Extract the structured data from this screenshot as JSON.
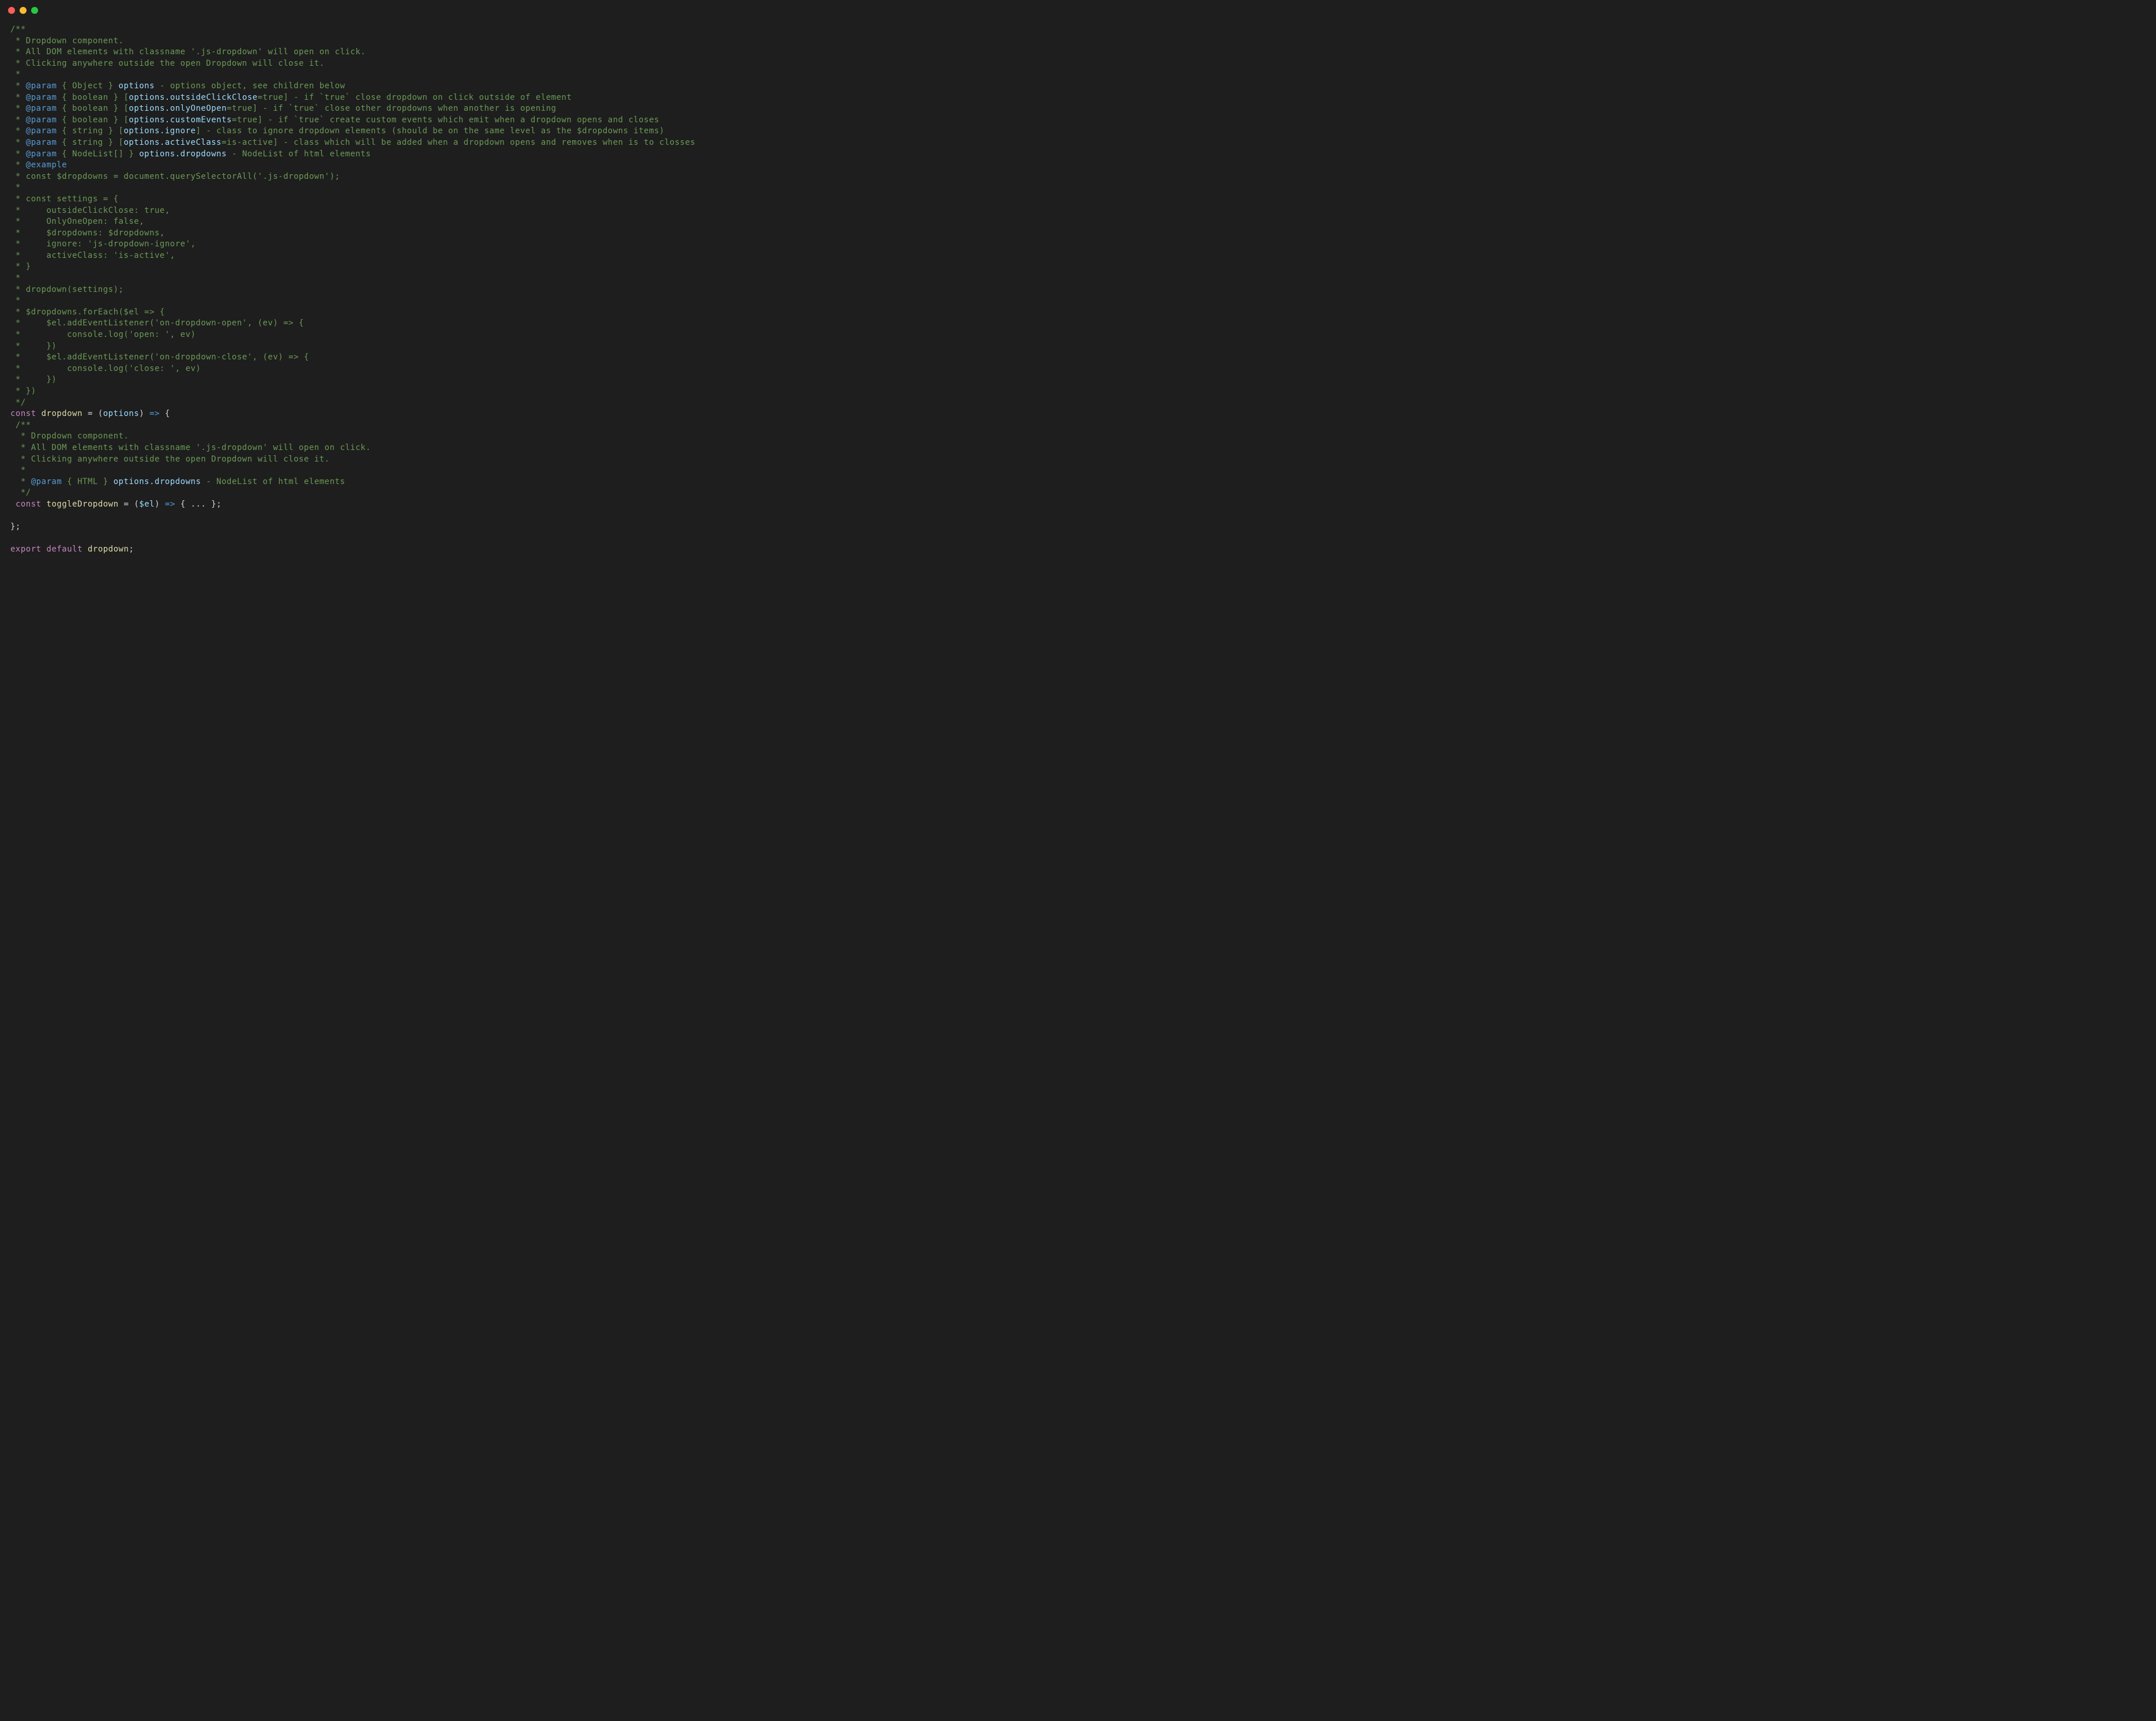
{
  "window": {
    "buttons": [
      "close",
      "minimize",
      "zoom"
    ]
  },
  "lines": [
    [
      [
        "c-comment",
        "/**"
      ]
    ],
    [
      [
        "c-comment",
        " * Dropdown component."
      ]
    ],
    [
      [
        "c-comment",
        " * All DOM elements with classname '.js-dropdown' will open on click."
      ]
    ],
    [
      [
        "c-comment",
        " * Clicking anywhere outside the open Dropdown will close it."
      ]
    ],
    [
      [
        "c-comment",
        " *"
      ]
    ],
    [
      [
        "c-comment",
        " * "
      ],
      [
        "c-tag",
        "@param"
      ],
      [
        "c-comment",
        " { Object } "
      ],
      [
        "c-param",
        "options"
      ],
      [
        "c-comment",
        " - options object, see children below"
      ]
    ],
    [
      [
        "c-comment",
        " * "
      ],
      [
        "c-tag",
        "@param"
      ],
      [
        "c-comment",
        " { boolean } ["
      ],
      [
        "c-param",
        "options.outsideClickClose"
      ],
      [
        "c-comment",
        "=true] - if `true` close dropdown on click outside of element"
      ]
    ],
    [
      [
        "c-comment",
        " * "
      ],
      [
        "c-tag",
        "@param"
      ],
      [
        "c-comment",
        " { boolean } ["
      ],
      [
        "c-param",
        "options.onlyOneOpen"
      ],
      [
        "c-comment",
        "=true] - if `true` close other dropdowns when another is opening"
      ]
    ],
    [
      [
        "c-comment",
        " * "
      ],
      [
        "c-tag",
        "@param"
      ],
      [
        "c-comment",
        " { boolean } ["
      ],
      [
        "c-param",
        "options.customEvents"
      ],
      [
        "c-comment",
        "=true] - if `true` create custom events which emit when a dropdown opens and closes"
      ]
    ],
    [
      [
        "c-comment",
        " * "
      ],
      [
        "c-tag",
        "@param"
      ],
      [
        "c-comment",
        " { string } ["
      ],
      [
        "c-param",
        "options.ignore"
      ],
      [
        "c-comment",
        "] - class to ignore dropdown elements (should be on the same level as the $dropdowns items)"
      ]
    ],
    [
      [
        "c-comment",
        " * "
      ],
      [
        "c-tag",
        "@param"
      ],
      [
        "c-comment",
        " { string } ["
      ],
      [
        "c-param",
        "options.activeClass"
      ],
      [
        "c-comment",
        "=is-active] - class which will be added when a dropdown opens and removes when is to closses"
      ]
    ],
    [
      [
        "c-comment",
        " * "
      ],
      [
        "c-tag",
        "@param"
      ],
      [
        "c-comment",
        " { NodeList[] } "
      ],
      [
        "c-param",
        "options.dropdowns"
      ],
      [
        "c-comment",
        " - NodeList of html elements"
      ]
    ],
    [
      [
        "c-comment",
        " * "
      ],
      [
        "c-tag",
        "@example"
      ]
    ],
    [
      [
        "c-comment",
        " * const $dropdowns = document.querySelectorAll('.js-dropdown');"
      ]
    ],
    [
      [
        "c-comment",
        " *"
      ]
    ],
    [
      [
        "c-comment",
        " * const settings = {"
      ]
    ],
    [
      [
        "c-comment",
        " *     outsideClickClose: true,"
      ]
    ],
    [
      [
        "c-comment",
        " *     OnlyOneOpen: false,"
      ]
    ],
    [
      [
        "c-comment",
        " *     $dropdowns: $dropdowns,"
      ]
    ],
    [
      [
        "c-comment",
        " *     ignore: 'js-dropdown-ignore',"
      ]
    ],
    [
      [
        "c-comment",
        " *     activeClass: 'is-active',"
      ]
    ],
    [
      [
        "c-comment",
        " * }"
      ]
    ],
    [
      [
        "c-comment",
        " *"
      ]
    ],
    [
      [
        "c-comment",
        " * dropdown(settings);"
      ]
    ],
    [
      [
        "c-comment",
        " *"
      ]
    ],
    [
      [
        "c-comment",
        " * $dropdowns.forEach($el => {"
      ]
    ],
    [
      [
        "c-comment",
        " *     $el.addEventListener('on-dropdown-open', (ev) => {"
      ]
    ],
    [
      [
        "c-comment",
        " *         console.log('open: ', ev)"
      ]
    ],
    [
      [
        "c-comment",
        " *     })"
      ]
    ],
    [
      [
        "c-comment",
        " *     $el.addEventListener('on-dropdown-close', (ev) => {"
      ]
    ],
    [
      [
        "c-comment",
        " *         console.log('close: ', ev)"
      ]
    ],
    [
      [
        "c-comment",
        " *     })"
      ]
    ],
    [
      [
        "c-comment",
        " * })"
      ]
    ],
    [
      [
        "c-comment",
        " */"
      ]
    ],
    [
      [
        "c-keyword",
        "const"
      ],
      [
        "c-plain",
        " "
      ],
      [
        "c-ident",
        "dropdown"
      ],
      [
        "c-plain",
        " = ("
      ],
      [
        "c-param",
        "options"
      ],
      [
        "c-plain",
        ") "
      ],
      [
        "c-arrow",
        "=>"
      ],
      [
        "c-plain",
        " {"
      ]
    ],
    [
      [
        "c-comment",
        " /**"
      ]
    ],
    [
      [
        "c-comment",
        "  * Dropdown component."
      ]
    ],
    [
      [
        "c-comment",
        "  * All DOM elements with classname '.js-dropdown' will open on click."
      ]
    ],
    [
      [
        "c-comment",
        "  * Clicking anywhere outside the open Dropdown will close it."
      ]
    ],
    [
      [
        "c-comment",
        "  *"
      ]
    ],
    [
      [
        "c-comment",
        "  * "
      ],
      [
        "c-tag",
        "@param"
      ],
      [
        "c-comment",
        " { HTML } "
      ],
      [
        "c-param",
        "options.dropdowns"
      ],
      [
        "c-comment",
        " - NodeList of html elements"
      ]
    ],
    [
      [
        "c-comment",
        "  */"
      ]
    ],
    [
      [
        "c-plain",
        " "
      ],
      [
        "c-keyword",
        "const"
      ],
      [
        "c-plain",
        " "
      ],
      [
        "c-ident",
        "toggleDropdown"
      ],
      [
        "c-plain",
        " = ("
      ],
      [
        "c-param",
        "$el"
      ],
      [
        "c-plain",
        ") "
      ],
      [
        "c-arrow",
        "=>"
      ],
      [
        "c-plain",
        " { ... };"
      ]
    ],
    [
      [
        "c-plain",
        ""
      ]
    ],
    [
      [
        "c-plain",
        "};"
      ]
    ],
    [
      [
        "c-plain",
        ""
      ]
    ],
    [
      [
        "c-keyword",
        "export"
      ],
      [
        "c-plain",
        " "
      ],
      [
        "c-keyword",
        "default"
      ],
      [
        "c-plain",
        " "
      ],
      [
        "c-ident",
        "dropdown"
      ],
      [
        "c-plain",
        ";"
      ]
    ]
  ]
}
